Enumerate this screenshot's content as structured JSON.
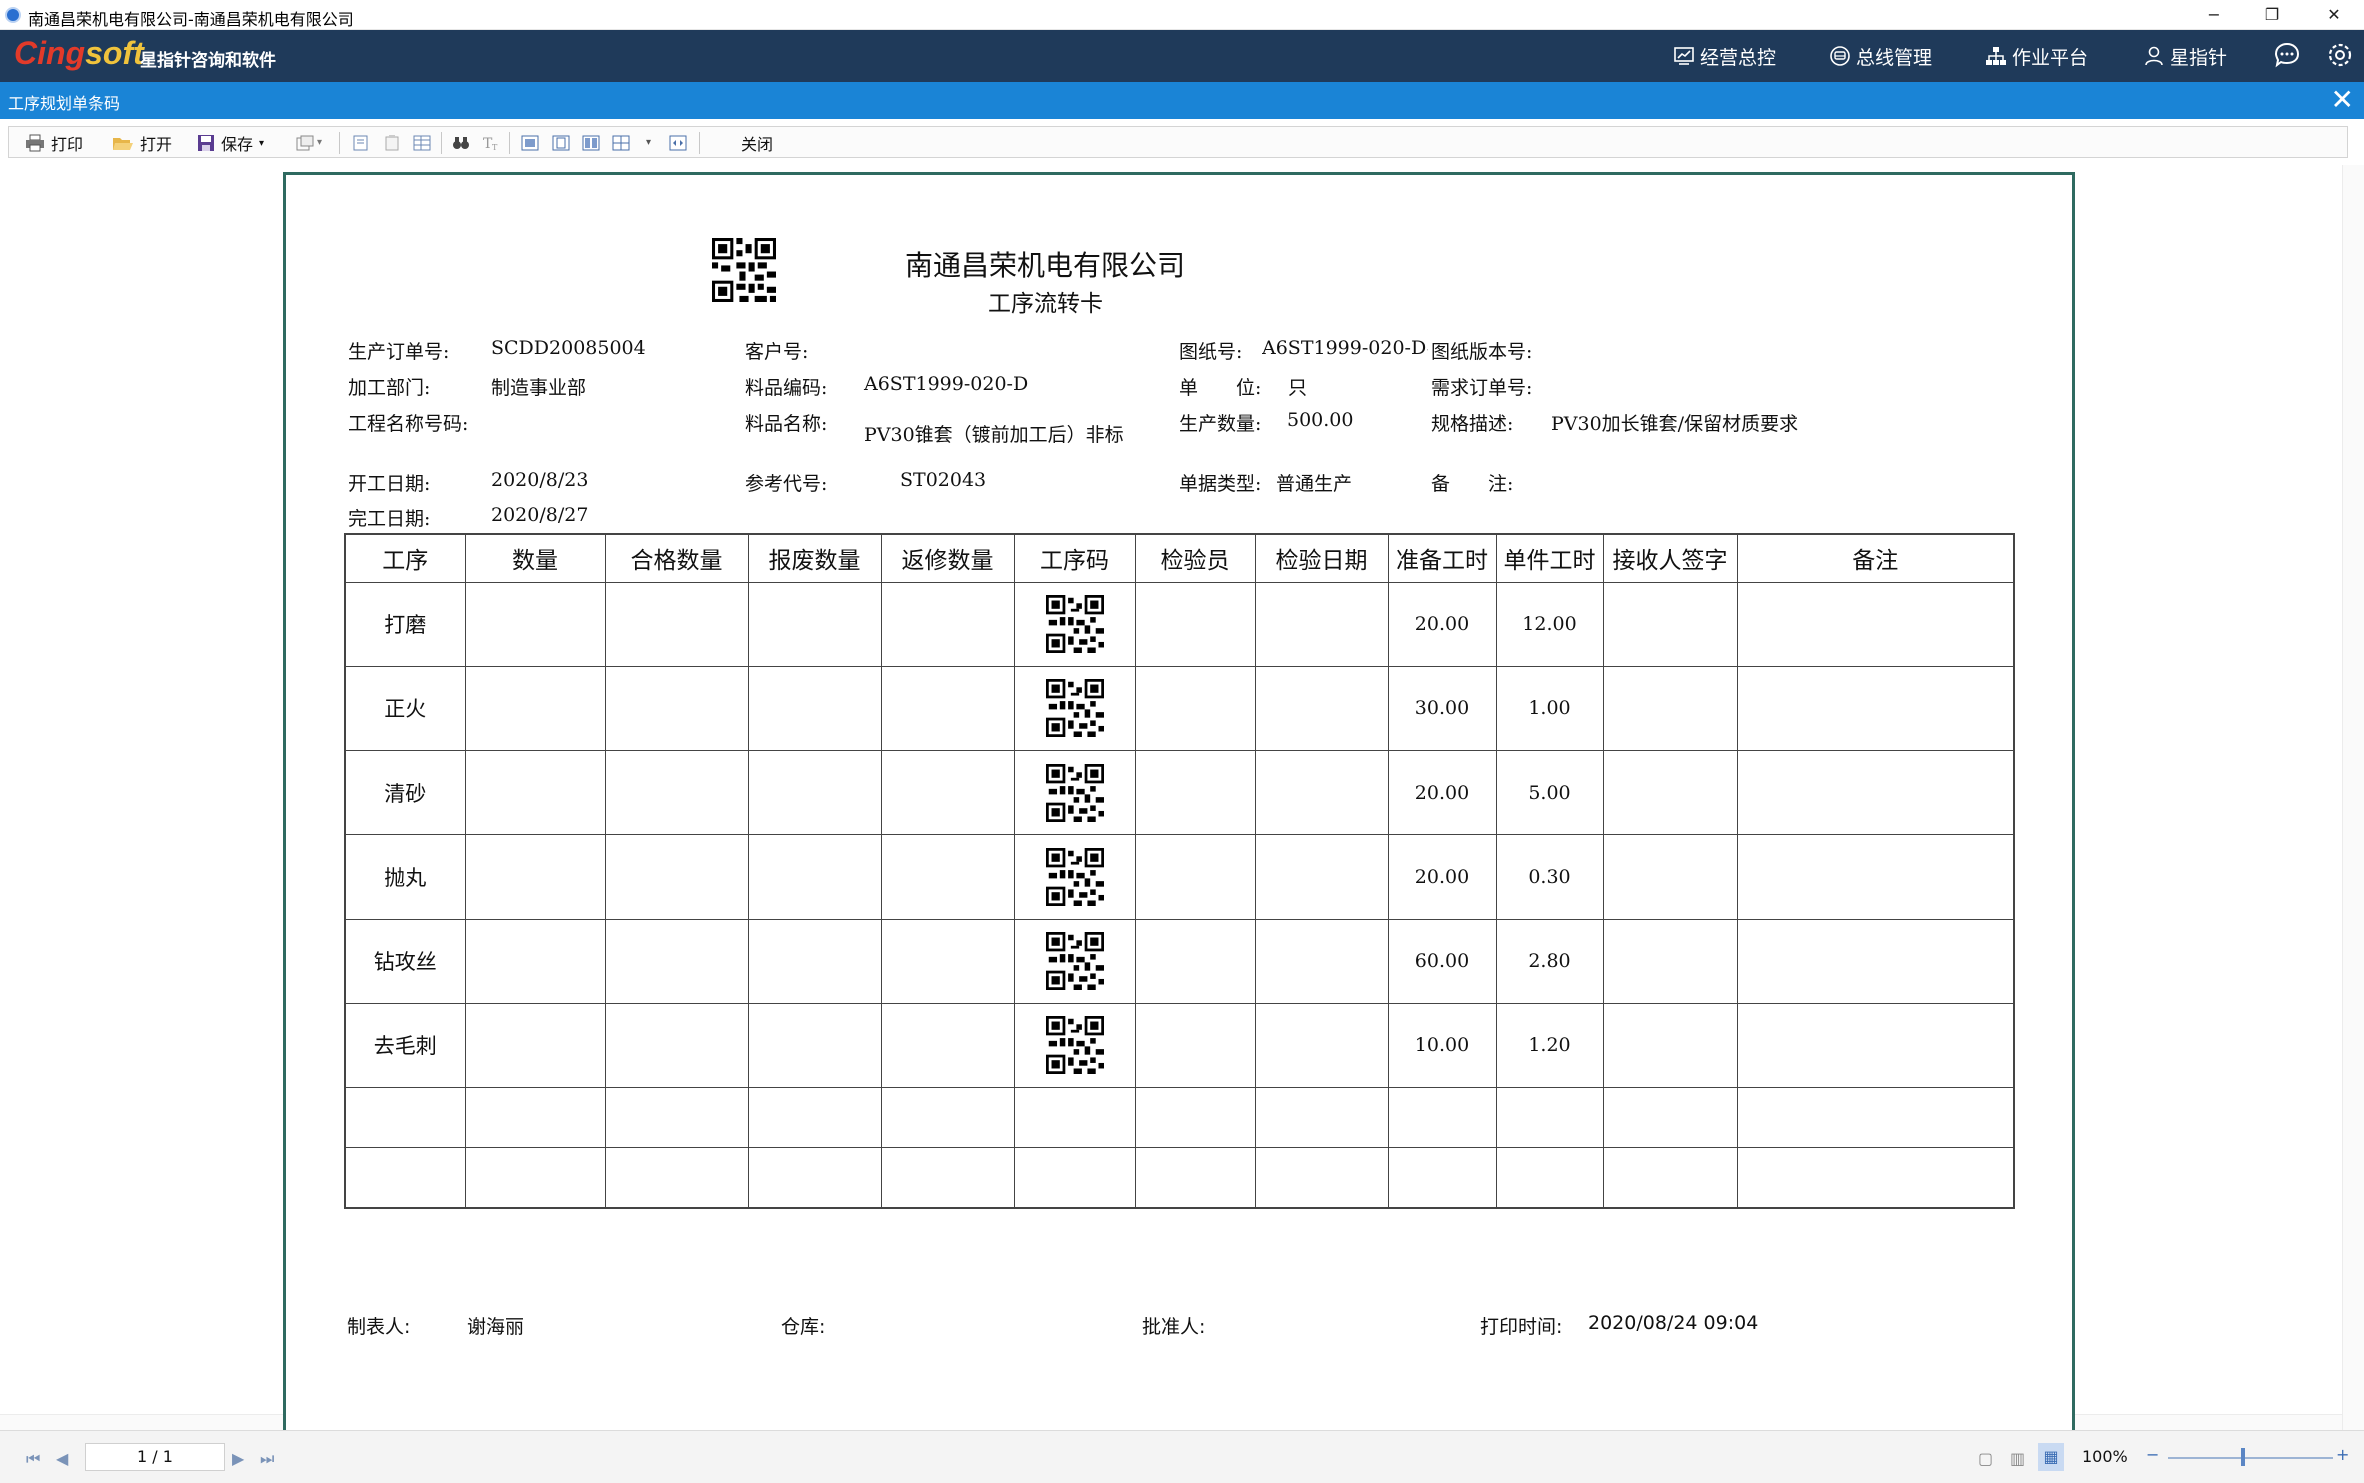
{
  "window": {
    "title": "南通昌荣机电有限公司-南通昌荣机电有限公司",
    "controls": [
      "−",
      "❐",
      "✕"
    ]
  },
  "header": {
    "logo_main": "Cing",
    "logo_accent": "soft",
    "slogan": "星指针咨询和软件",
    "nav": [
      {
        "label": "经营总控",
        "icon": "chart-monitor-icon"
      },
      {
        "label": "总线管理",
        "icon": "bus-icon"
      },
      {
        "label": "作业平台",
        "icon": "org-chart-icon"
      },
      {
        "label": "星指针",
        "icon": "user-icon"
      }
    ],
    "icons": [
      "chat-icon",
      "settings-gear-icon"
    ]
  },
  "tab": {
    "title": "工序规划单条码",
    "close": "✕"
  },
  "toolbar": {
    "print": "打印",
    "open": "打开",
    "save": "保存",
    "close": "关闭"
  },
  "document": {
    "company": "南通昌荣机电有限公司",
    "subtitle": "工序流转卡",
    "fields": {
      "order_no_label": "生产订单号:",
      "order_no": "SCDD20085004",
      "customer_label": "客户号:",
      "customer": "",
      "drawing_label": "图纸号:",
      "drawing": "A6ST1999-020-D#",
      "drawing_ver_label": "图纸版本号:",
      "drawing_ver": "",
      "dept_label": "加工部门:",
      "dept": "制造事业部",
      "item_code_label": "料品编码:",
      "item_code": "A6ST1999-020-D",
      "unit_label": "单　　位:",
      "unit": "只",
      "demand_label": "需求订单号:",
      "demand": "",
      "project_label": "工程名称号码:",
      "project": "",
      "item_name_label": "料品名称:",
      "item_name": "PV30锥套（镀前加工后）非标",
      "qty_label": "生产数量:",
      "qty": "500.00",
      "spec_label": "规格描述:",
      "spec": "PV30加长锥套/保留材质要求",
      "start_label": "开工日期:",
      "start": "2020/8/23",
      "ref_label": "参考代号:",
      "ref": "ST02043",
      "doc_type_label": "单据类型:",
      "doc_type": "普通生产",
      "remark_label": "备　　注:",
      "remark": "",
      "finish_label": "完工日期:",
      "finish": "2020/8/27"
    },
    "table": {
      "headers": [
        "工序",
        "数量",
        "合格数量",
        "报废数量",
        "返修数量",
        "工序码",
        "检验员",
        "检验日期",
        "准备工时",
        "单件工时",
        "接收人签字",
        "备注"
      ],
      "rows": [
        {
          "step": "打磨",
          "prep": "20.00",
          "unit": "12.00"
        },
        {
          "step": "正火",
          "prep": "30.00",
          "unit": "1.00"
        },
        {
          "step": "清砂",
          "prep": "20.00",
          "unit": "5.00"
        },
        {
          "step": "抛丸",
          "prep": "20.00",
          "unit": "0.30"
        },
        {
          "step": "钻攻丝",
          "prep": "60.00",
          "unit": "2.80"
        },
        {
          "step": "去毛刺",
          "prep": "10.00",
          "unit": "1.20"
        }
      ]
    },
    "footer": {
      "maker_label": "制表人:",
      "maker": "谢海丽",
      "warehouse_label": "仓库:",
      "warehouse": "",
      "approver_label": "批准人:",
      "approver": "",
      "print_time_label": "打印时间:",
      "print_time": "2020/08/24 09:04"
    }
  },
  "statusbar": {
    "page": "1 / 1",
    "zoom": "100%",
    "zoom_minus": "−",
    "zoom_plus": "+"
  }
}
